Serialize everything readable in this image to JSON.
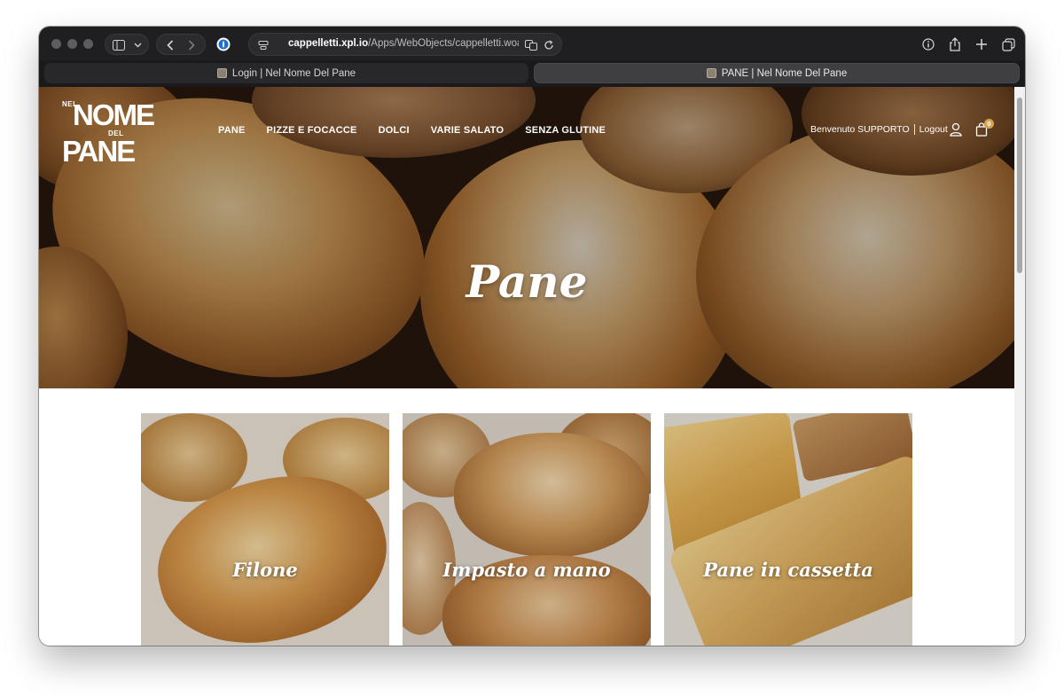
{
  "browser": {
    "url_host": "cappelletti.xpl.io",
    "url_path": "/Apps/WebObjects/cappelletti.woa/wa/m",
    "tabs": [
      {
        "label": "Login | Nel Nome Del Pane",
        "active": false
      },
      {
        "label": "PANE | Nel Nome Del Pane",
        "active": true
      }
    ]
  },
  "site": {
    "logo": {
      "line1": "NEL",
      "line2": "NOME",
      "line3": "DEL",
      "line4": "PANE"
    },
    "nav": [
      "PANE",
      "PIZZE E FOCACCE",
      "DOLCI",
      "VARIE SALATO",
      "SENZA GLUTINE"
    ],
    "welcome": "Benvenuto SUPPORTO",
    "logout": "Logout",
    "cart_count": "0"
  },
  "hero": {
    "title": "Pane"
  },
  "categories": [
    {
      "title": "Filone"
    },
    {
      "title": "Impasto a mano"
    },
    {
      "title": "Pane in cassetta"
    }
  ],
  "colors": {
    "accent": "#d9a34f",
    "chrome": "#1f1f21"
  }
}
